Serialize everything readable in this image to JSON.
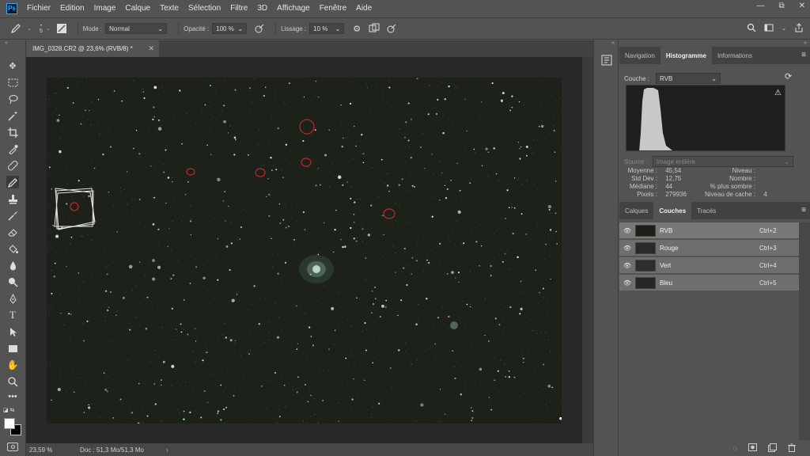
{
  "app": {
    "logo": "Ps"
  },
  "menu": [
    "Fichier",
    "Edition",
    "Image",
    "Calque",
    "Texte",
    "Sélection",
    "Filtre",
    "3D",
    "Affichage",
    "Fenêtre",
    "Aide"
  ],
  "window_controls": {
    "minimize": "—",
    "restore": "⧉",
    "close": "✕"
  },
  "options": {
    "brush_size": "5",
    "mode_label": "Mode :",
    "mode_value": "Normal",
    "opacity_label": "Opacité :",
    "opacity_value": "100 %",
    "smoothing_label": "Lissage :",
    "smoothing_value": "10 %"
  },
  "document": {
    "tab_title": "IMG_0328.CR2 @ 23,6% (RVB/8) *",
    "zoom": "23,59 %",
    "doc_info": "Doc : 51,3 Mo/51,3 Mo"
  },
  "histogram_panel": {
    "tabs": [
      "Navigation",
      "Histogramme",
      "Informations"
    ],
    "active_tab": "Histogramme",
    "channel_label": "Couche :",
    "channel_value": "RVB",
    "source_label": "Source :",
    "source_value": "Image entière",
    "stats_left": [
      {
        "label": "Moyenne :",
        "value": "45,54"
      },
      {
        "label": "Std Dev :",
        "value": "12,75"
      },
      {
        "label": "Médiane :",
        "value": "44"
      },
      {
        "label": "Pixels :",
        "value": "279936"
      }
    ],
    "stats_right": [
      {
        "label": "Niveau :",
        "value": ""
      },
      {
        "label": "Nombre :",
        "value": ""
      },
      {
        "label": "% plus sombre :",
        "value": ""
      },
      {
        "label": "Niveau de cache :",
        "value": "4"
      }
    ]
  },
  "layers_panel": {
    "tabs": [
      "Calques",
      "Couches",
      "Tracés"
    ],
    "active_tab": "Couches",
    "channels": [
      {
        "name": "RVB",
        "shortcut": "Ctrl+2"
      },
      {
        "name": "Rouge",
        "shortcut": "Ctrl+3"
      },
      {
        "name": "Vert",
        "shortcut": "Ctrl+4"
      },
      {
        "name": "Bleu",
        "shortcut": "Ctrl+5"
      }
    ]
  },
  "colors": {
    "ui_bg": "#535353",
    "canvas_bg": "#282828",
    "image_bg": "#1c2219",
    "selection_red": "#c0262b",
    "accent_ps": "#31a8ff"
  }
}
